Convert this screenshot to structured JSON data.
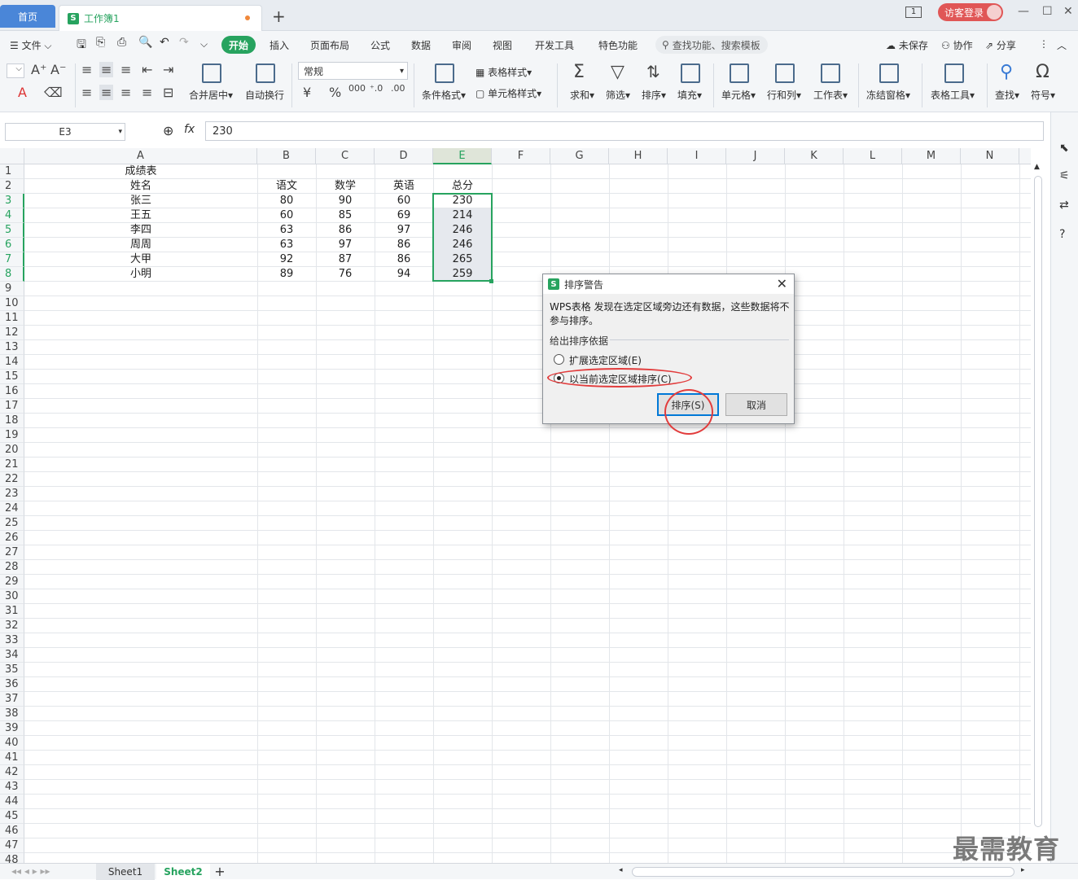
{
  "titlebar": {
    "home_tab": "首页",
    "doc_tab": "工作簿1",
    "new_tab": "+",
    "login": "访客登录",
    "page_indicator": "1"
  },
  "menu": {
    "file": "文件",
    "tabs": [
      "开始",
      "插入",
      "页面布局",
      "公式",
      "数据",
      "审阅",
      "视图",
      "开发工具",
      "特色功能"
    ],
    "search": "查找功能、搜索模板",
    "unsaved": "未保存",
    "collab": "协作",
    "share": "分享"
  },
  "ribbon": {
    "merge": "合并居中",
    "wrap": "自动换行",
    "number_format": "常规",
    "table_style": "表格样式",
    "cell_style": "单元格样式",
    "cond_format": "条件格式",
    "sum": "求和",
    "filter": "筛选",
    "sort": "排序",
    "fill": "填充",
    "cell": "单元格",
    "rowcol": "行和列",
    "worksheet": "工作表",
    "freeze": "冻结窗格",
    "table_tools": "表格工具",
    "find": "查找",
    "symbol": "符号"
  },
  "formula_bar": {
    "name_box": "E3",
    "fx": "fx",
    "value": "230"
  },
  "columns": [
    "A",
    "B",
    "C",
    "D",
    "E",
    "F",
    "G",
    "H",
    "I",
    "J",
    "K",
    "L",
    "M",
    "N"
  ],
  "table": {
    "title": "成绩表",
    "headers": [
      "姓名",
      "语文",
      "数学",
      "英语",
      "总分"
    ],
    "rows": [
      [
        "张三",
        "80",
        "90",
        "60",
        "230"
      ],
      [
        "王五",
        "60",
        "85",
        "69",
        "214"
      ],
      [
        "李四",
        "63",
        "86",
        "97",
        "246"
      ],
      [
        "周周",
        "63",
        "97",
        "86",
        "246"
      ],
      [
        "大甲",
        "92",
        "87",
        "86",
        "265"
      ],
      [
        "小明",
        "89",
        "76",
        "94",
        "259"
      ]
    ]
  },
  "sheet_tabs": [
    "Sheet1",
    "Sheet2"
  ],
  "active_sheet": "Sheet2",
  "dialog": {
    "title": "排序警告",
    "message": "WPS表格 发现在选定区域旁边还有数据，这些数据将不参与排序。",
    "group_label": "给出排序依据",
    "option_expand": "扩展选定区域(E)",
    "option_current": "以当前选定区域排序(C)",
    "selected_option": "option_current",
    "sort_button": "排序(S)",
    "cancel_button": "取消",
    "close": "✕"
  },
  "watermark": "最需教育",
  "colors": {
    "accent_green": "#27a35f",
    "home_blue": "#4a86d8",
    "login_red": "#e05656",
    "annotation_red": "#e23c3c"
  }
}
